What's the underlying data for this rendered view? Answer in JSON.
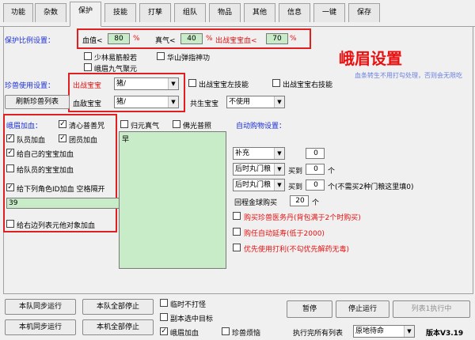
{
  "tabs": [
    "功能",
    "杂数",
    "保护",
    "技能",
    "打孳",
    "组队",
    "物品",
    "其他",
    "信息",
    "一键",
    "保存"
  ],
  "active_tab": 2,
  "protect": {
    "section_title": "保护比例设置：",
    "hp_label": "血值<",
    "hp_value": "80",
    "pct": "%",
    "mp_label": "真气<",
    "mp_value": "40",
    "pet_hp_label": "出战宝宝血<",
    "pet_hp_value": "70",
    "shaolin_repair": "少林易筋般若",
    "huashan_self": "华山弹指神功",
    "emei_qi": "峨眉九气聚元",
    "watermark": "峨眉设置"
  },
  "pet": {
    "section_title": "珍兽使用设置：",
    "battle_pet_label": "出战宝宝",
    "battle_pet_value": "猪/",
    "refresh_btn": "刷新珍兽列表",
    "blood_pet_label": "血敌宝宝",
    "blood_pet_value": "猪/",
    "left_skill": "出战宝宝左技能",
    "right_skill": "出战宝宝右技能",
    "note": "血条转生不用打勾处理，否则会无限吃",
    "shared_label": "共生宝宝",
    "shared_value": "不使用"
  },
  "emei": {
    "title": "峨眉加血：",
    "qingxin": "清心普善咒",
    "team_heal": "队员加血",
    "member_heal": "团员加血",
    "self_pet": "给自己的宝宝加血",
    "team_pet": "给队员的宝宝加血",
    "id_heal": "给下列角色ID加血   空格隔开",
    "id_value": "39",
    "right_first": "给右边列表元他对象加血",
    "list_item": "早",
    "guqi": "归元真气",
    "fozhao": "佛光普照"
  },
  "merchant": {
    "title": "自动购物设置：",
    "r1_item": "补充",
    "r1_qty": "0",
    "r2_item": "后时丸门粮",
    "r2_buy": "买到",
    "r2_qty": "0",
    "unit": "个",
    "r3_item": "后时丸门粮",
    "r3_buy": "买到",
    "r3_qty": "0",
    "r3_note": "个(不需买2种门粮这里填0)",
    "r4_label": "回程金球购买",
    "r4_qty": "20",
    "opt1": "购买珍兽医务丹(背包满于2个时购买)",
    "opt2": "购任自动延寿(低于2000)",
    "opt3": "优先使用打利(不勾优先解药无毒)"
  },
  "footer": {
    "btn_team_sync": "本队同步运行",
    "btn_team_stop": "本队全部停止",
    "btn_machine_sync": "本机同步运行",
    "btn_machine_stop": "本机全部停止",
    "cb_no_attack": "临时不打怪",
    "cb_no_target": "副本选中目标",
    "cb_emei_heal": "峨眉加血",
    "cb_pet_sorrow": "珍兽烦恼",
    "btn_pause": "暂停",
    "btn_stop": "停止运行",
    "btn_list": "列表1执行中",
    "run_label": "执行完所有列表",
    "run_value": "原地待命",
    "version": "版本V3.19"
  },
  "colors": {
    "accent_red": "#e81010",
    "blue": "#1a2fd6",
    "green_input": "#c8ecc8"
  }
}
